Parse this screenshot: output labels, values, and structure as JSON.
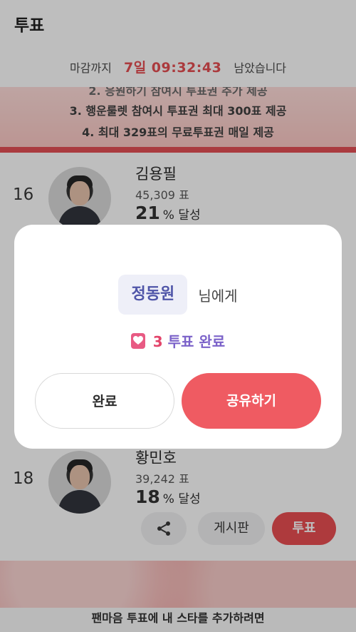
{
  "header": {
    "title": "투표"
  },
  "deadline": {
    "prefix": "마감까지",
    "time": "7일 09:32:43",
    "suffix": "남았습니다"
  },
  "banner": {
    "lines": [
      "2. 응원하기 참여시 투표권 추가 제공",
      "3. 행운룰렛 참여시 투표권 최대 300표 제공",
      "4. 최대 329표의 무료투표권 매일 제공"
    ]
  },
  "candidates": [
    {
      "rank": "16",
      "name": "김용필",
      "votes": "45,309 표",
      "percent": "21",
      "percent_suffix": "% 달성"
    },
    {
      "rank": "18",
      "name": "황민호",
      "votes": "39,242 표",
      "percent": "18",
      "percent_suffix": "% 달성"
    }
  ],
  "actions": {
    "board_label": "게시판",
    "vote_label": "투표"
  },
  "bottom_bar": {
    "text": "팬마음 투표에 내 스타를 추가하려면"
  },
  "modal": {
    "recipient_name": "정동원",
    "recipient_suffix": "님에게",
    "vote_count": "3",
    "vote_done_text": "투표 완료",
    "done_button": "완료",
    "share_button": "공유하기"
  },
  "colors": {
    "accent_red": "#ef5b62",
    "purple": "#7b62c9",
    "deadline_red": "#e5484d"
  }
}
